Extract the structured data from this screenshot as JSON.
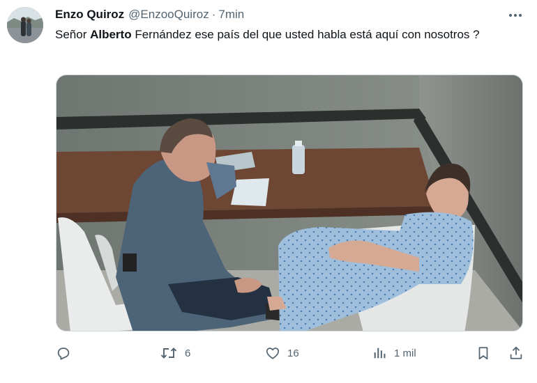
{
  "tweet": {
    "display_name": "Enzo Quiroz",
    "handle": "@EnzooQuiroz",
    "separator": "·",
    "time": "7min",
    "text_before": "Señor ",
    "text_bold": "Alberto",
    "text_after": " Fernández ese país del que usted habla está aquí con nosotros ?"
  },
  "actions": {
    "reply": {
      "icon": "reply-icon",
      "count": ""
    },
    "retweet": {
      "icon": "retweet-icon",
      "count": "6"
    },
    "like": {
      "icon": "heart-icon",
      "count": "16"
    },
    "views": {
      "icon": "views-icon",
      "count": "1 mil"
    },
    "bookmark": {
      "icon": "bookmark-icon"
    },
    "share": {
      "icon": "share-icon"
    }
  },
  "colors": {
    "text": "#0f1419",
    "secondary": "#536471",
    "border": "#cfd9de"
  }
}
